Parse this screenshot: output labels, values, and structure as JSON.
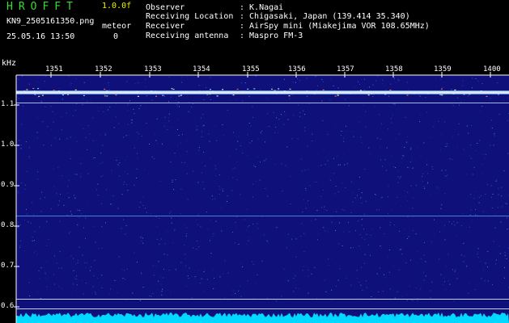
{
  "header": {
    "app_title": "HROFFT",
    "version": "1.0.0f",
    "filename": "KN9_2505161350.png",
    "datetime": "25.05.16 13:50",
    "meteor_label": "meteor",
    "meteor_count": "0"
  },
  "info": [
    {
      "label": "Observer",
      "value": ": K.Nagai"
    },
    {
      "label": "Receiving Location",
      "value": ": Chigasaki, Japan (139.414 35.340)"
    },
    {
      "label": "Receiver",
      "value": ": AirSpy mini (Miakejima VOR 108.65MHz)"
    },
    {
      "label": "Receiving antenna",
      "value": ": Maspro FM-3"
    }
  ],
  "axis": {
    "unit": "kHz",
    "x_ticks": [
      "1351",
      "1352",
      "1353",
      "1354",
      "1355",
      "1356",
      "1357",
      "1358",
      "1359",
      "1400"
    ],
    "y_ticks": [
      "1.1",
      "1.0",
      "0.9",
      "0.8",
      "0.7",
      "0.6"
    ]
  },
  "colors": {
    "background": "#000000",
    "spectrogram_bg": "#10107a",
    "title_green": "#33dd33",
    "version_yellow": "#f2f200",
    "text_white": "#ffffff",
    "carrier_line": "#e8f0ff",
    "noise_floor": "#00d8ff"
  }
}
